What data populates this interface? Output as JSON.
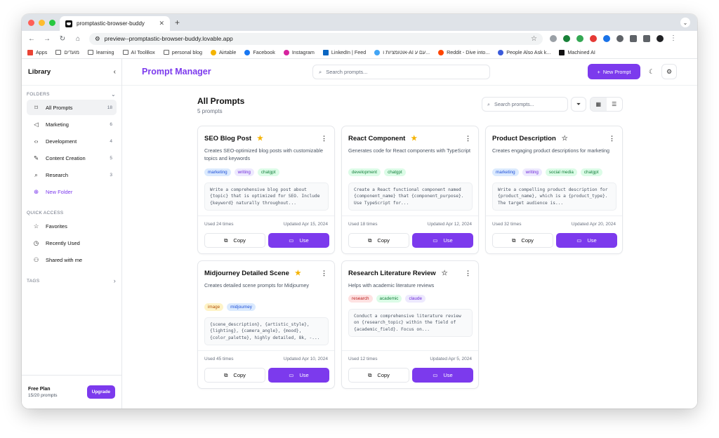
{
  "browser": {
    "tab_title": "promptastic-browser-buddy",
    "url": "preview--promptastic-browser-buddy.lovable.app",
    "bookmarks": [
      {
        "label": "Apps"
      },
      {
        "label": "מועדים"
      },
      {
        "label": "learning"
      },
      {
        "label": "AI ToolBox"
      },
      {
        "label": "personal blog"
      },
      {
        "label": "Airtable"
      },
      {
        "label": "Facebook"
      },
      {
        "label": "Instagram"
      },
      {
        "label": "LinkedIn | Feed"
      },
      {
        "label": "אוטומציות ו-AI עם ע..."
      },
      {
        "label": "Reddit - Dive into..."
      },
      {
        "label": "People Also Ask k..."
      },
      {
        "label": "Machined AI"
      }
    ]
  },
  "sidebar": {
    "title": "Library",
    "folders_label": "FOLDERS",
    "folders": [
      {
        "label": "All Prompts",
        "count": "18",
        "icon": "bookmark-icon"
      },
      {
        "label": "Marketing",
        "count": "6",
        "icon": "megaphone-icon"
      },
      {
        "label": "Development",
        "count": "4",
        "icon": "code-icon"
      },
      {
        "label": "Content Creation",
        "count": "5",
        "icon": "pencil-icon"
      },
      {
        "label": "Research",
        "count": "3",
        "icon": "search-icon"
      }
    ],
    "new_folder": "New Folder",
    "quick_access_label": "QUICK ACCESS",
    "quick_access": [
      {
        "label": "Favorites",
        "icon": "star-icon"
      },
      {
        "label": "Recently Used",
        "icon": "clock-icon"
      },
      {
        "label": "Shared with me",
        "icon": "users-icon"
      }
    ],
    "tags_label": "TAGS",
    "plan": {
      "name": "Free Plan",
      "usage": "15/20 prompts",
      "upgrade": "Upgrade"
    }
  },
  "header": {
    "brand": "Prompt Manager",
    "search_placeholder": "Search prompts...",
    "new_prompt": "New Prompt"
  },
  "page": {
    "title": "All Prompts",
    "subtitle": "5 prompts",
    "search_placeholder": "Search prompts..."
  },
  "cards": [
    {
      "title": "SEO Blog Post",
      "starred": true,
      "description": "Creates SEO-optimized blog posts with customizable topics and keywords",
      "tags": [
        "marketing",
        "writing",
        "chatgpt"
      ],
      "preview": "Write a comprehensive blog post about {topic} that is optimized for SEO. Include {keyword} naturally throughout...",
      "used": "Used 24 times",
      "updated": "Updated Apr 15, 2024"
    },
    {
      "title": "React Component",
      "starred": true,
      "description": "Generates code for React components with TypeScript",
      "tags": [
        "development",
        "chatgpt"
      ],
      "preview": "Create a React functional component named {component_name} that {component_purpose}. Use TypeScript for...",
      "used": "Used 18 times",
      "updated": "Updated Apr 12, 2024"
    },
    {
      "title": "Product Description",
      "starred": false,
      "description": "Creates engaging product descriptions for marketing",
      "tags": [
        "marketing",
        "writing",
        "social media",
        "chatgpt"
      ],
      "preview": "Write a compelling product description for {product_name}, which is a {product_type}. The target audience is...",
      "used": "Used 32 times",
      "updated": "Updated Apr 20, 2024"
    },
    {
      "title": "Midjourney Detailed Scene",
      "starred": true,
      "description": "Creates detailed scene prompts for Midjourney",
      "tags": [
        "image",
        "midjourney"
      ],
      "preview": "{scene_description}, {artistic_style}, {lighting}, {camera_angle}, {mood}, {color_palette}, highly detailed, 8k, -...",
      "used": "Used 45 times",
      "updated": "Updated Apr 10, 2024"
    },
    {
      "title": "Research Literature Review",
      "starred": false,
      "description": "Helps with academic literature reviews",
      "tags": [
        "research",
        "academic",
        "claude"
      ],
      "preview": "Conduct a comprehensive literature review on {research_topic} within the field of {academic_field}. Focus on...",
      "used": "Used 12 times",
      "updated": "Updated Apr 5, 2024"
    }
  ],
  "buttons": {
    "copy": "Copy",
    "use": "Use"
  },
  "colors": {
    "accent": "#7c3aed",
    "tag_marketing": "#dbeafe",
    "tag_writing": "#ede9fe",
    "tag_chatgpt": "#dcfce7",
    "tag_development": "#dcfce7",
    "tag_social": "#dcfce7",
    "tag_image": "#fef3c7",
    "tag_midjourney": "#dbeafe",
    "tag_research": "#fee2e2",
    "tag_academic": "#dcfce7",
    "tag_claude": "#ede9fe"
  }
}
